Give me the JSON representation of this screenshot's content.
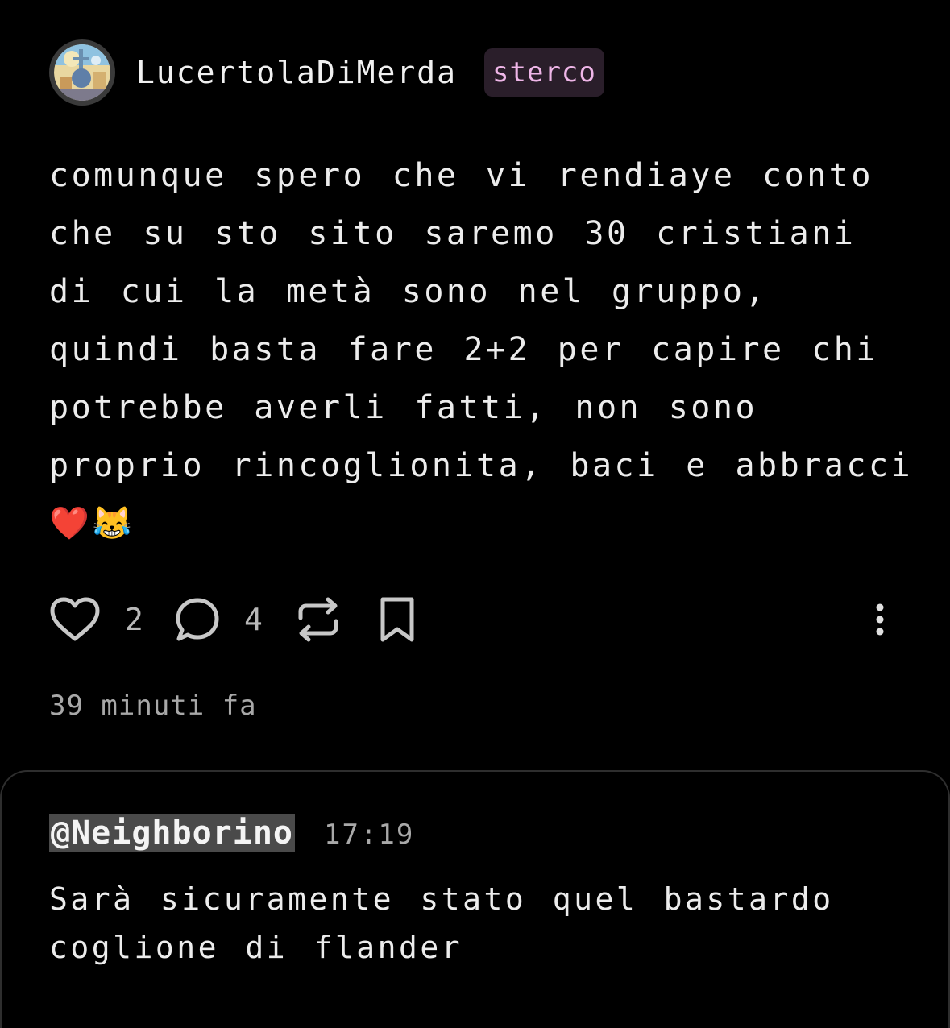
{
  "post": {
    "author": {
      "username": "LucertolaDiMerda",
      "badge": "sterco",
      "avatar": "avatar-illustration"
    },
    "text": "comunque spero che vi rendiaye conto che su sto sito saremo 30 cristiani di cui la metà sono nel gruppo, quindi basta fare 2+2 per capire chi potrebbe averli fatti, non sono proprio rincoglionita, baci e abbracci ❤️😹",
    "actions": {
      "like_icon": "heart-icon",
      "like_count": "2",
      "comment_icon": "comment-bubble-icon",
      "comment_count": "4",
      "repost_icon": "repost-icon",
      "bookmark_icon": "bookmark-icon",
      "more_icon": "more-vertical-icon"
    },
    "timestamp": "39 minuti fa"
  },
  "reply": {
    "mention": "@Neighborino",
    "time": "17:19",
    "text": "Sarà sicuramente stato quel bastardo coglione di flander"
  },
  "colors": {
    "background": "#000000",
    "text": "#ececec",
    "muted": "#a8a8a8",
    "badge_bg": "#2a1e2a",
    "badge_text": "#efb6e8",
    "mention_bg": "#4a4a4a"
  }
}
